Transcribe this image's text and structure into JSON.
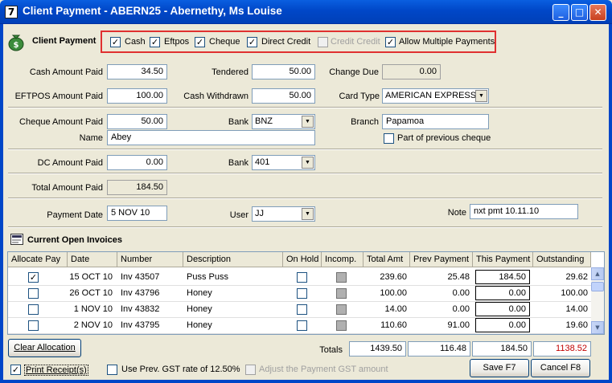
{
  "window": {
    "icon_glyph": "7",
    "title": "Client Payment - ABERN25 - Abernethy, Ms Louise",
    "min": "_",
    "max": "□",
    "close": "✕"
  },
  "header": {
    "label": "Client Payment",
    "icon": "money-bag-icon"
  },
  "payment_types": [
    {
      "label": "Cash",
      "checked": true,
      "enabled": true
    },
    {
      "label": "Eftpos",
      "checked": true,
      "enabled": true
    },
    {
      "label": "Cheque",
      "checked": true,
      "enabled": true
    },
    {
      "label": "Direct Credit",
      "checked": true,
      "enabled": true
    },
    {
      "label": "Credit Credit",
      "checked": false,
      "enabled": false
    },
    {
      "label": "Allow Multiple Payments",
      "checked": true,
      "enabled": true
    }
  ],
  "cash": {
    "amount_label": "Cash Amount Paid",
    "amount": "34.50",
    "tendered_label": "Tendered",
    "tendered": "50.00",
    "change_label": "Change Due",
    "change": "0.00"
  },
  "eftpos": {
    "amount_label": "EFTPOS Amount Paid",
    "amount": "100.00",
    "withdrawn_label": "Cash Withdrawn",
    "withdrawn": "50.00",
    "card_label": "Card Type",
    "card": "AMERICAN EXPRESS"
  },
  "cheque": {
    "amount_label": "Cheque Amount Paid",
    "amount": "50.00",
    "bank_label": "Bank",
    "bank": "BNZ",
    "branch_label": "Branch",
    "branch": "Papamoa",
    "name_label": "Name",
    "name": "Abey",
    "prev_label": "Part of previous cheque"
  },
  "dc": {
    "amount_label": "DC Amount Paid",
    "amount": "0.00",
    "bank_label": "Bank",
    "bank": "401"
  },
  "total": {
    "label": "Total Amount Paid",
    "value": "184.50"
  },
  "payment": {
    "date_label": "Payment Date",
    "date": "5 NOV 10",
    "user_label": "User",
    "user": "JJ",
    "note_label": "Note",
    "note": "nxt pmt 10.11.10"
  },
  "invoices": {
    "title": "Current Open Invoices",
    "columns": [
      "Allocate Pay",
      "Date",
      "Number",
      "Description",
      "On Hold",
      "Incomp.",
      "Total Amt",
      "Prev Payment",
      "This Payment",
      "Outstanding"
    ],
    "rows": [
      {
        "allocate": true,
        "date": "15 OCT 10",
        "number": "Inv 43507",
        "description": "Puss Puss",
        "total": "239.60",
        "prev": "25.48",
        "this": "184.50",
        "outstanding": "29.62"
      },
      {
        "allocate": false,
        "date": "26 OCT 10",
        "number": "Inv 43796",
        "description": "Honey",
        "total": "100.00",
        "prev": "0.00",
        "this": "0.00",
        "outstanding": "100.00"
      },
      {
        "allocate": false,
        "date": "1 NOV 10",
        "number": "Inv 43832",
        "description": "Honey",
        "total": "14.00",
        "prev": "0.00",
        "this": "0.00",
        "outstanding": "14.00"
      },
      {
        "allocate": false,
        "date": "2 NOV 10",
        "number": "Inv 43795",
        "description": "Honey",
        "total": "110.60",
        "prev": "91.00",
        "this": "0.00",
        "outstanding": "19.60"
      }
    ]
  },
  "totals": {
    "label": "Totals",
    "total": "1439.50",
    "prev": "116.48",
    "this": "184.50",
    "outstanding": "1138.52"
  },
  "footer": {
    "clear_label": "Clear Allocation",
    "print_label": "Print Receipt(s)",
    "gst_label": "Use Prev. GST rate of 12.50%",
    "adjust_label": "Adjust the Payment GST amount",
    "save_label": "Save F7",
    "cancel_label": "Cancel F8"
  },
  "colors": {
    "title_bar": "#0A5FE0",
    "outstanding_total": "#C00000",
    "highlight_box": "#E03030"
  }
}
